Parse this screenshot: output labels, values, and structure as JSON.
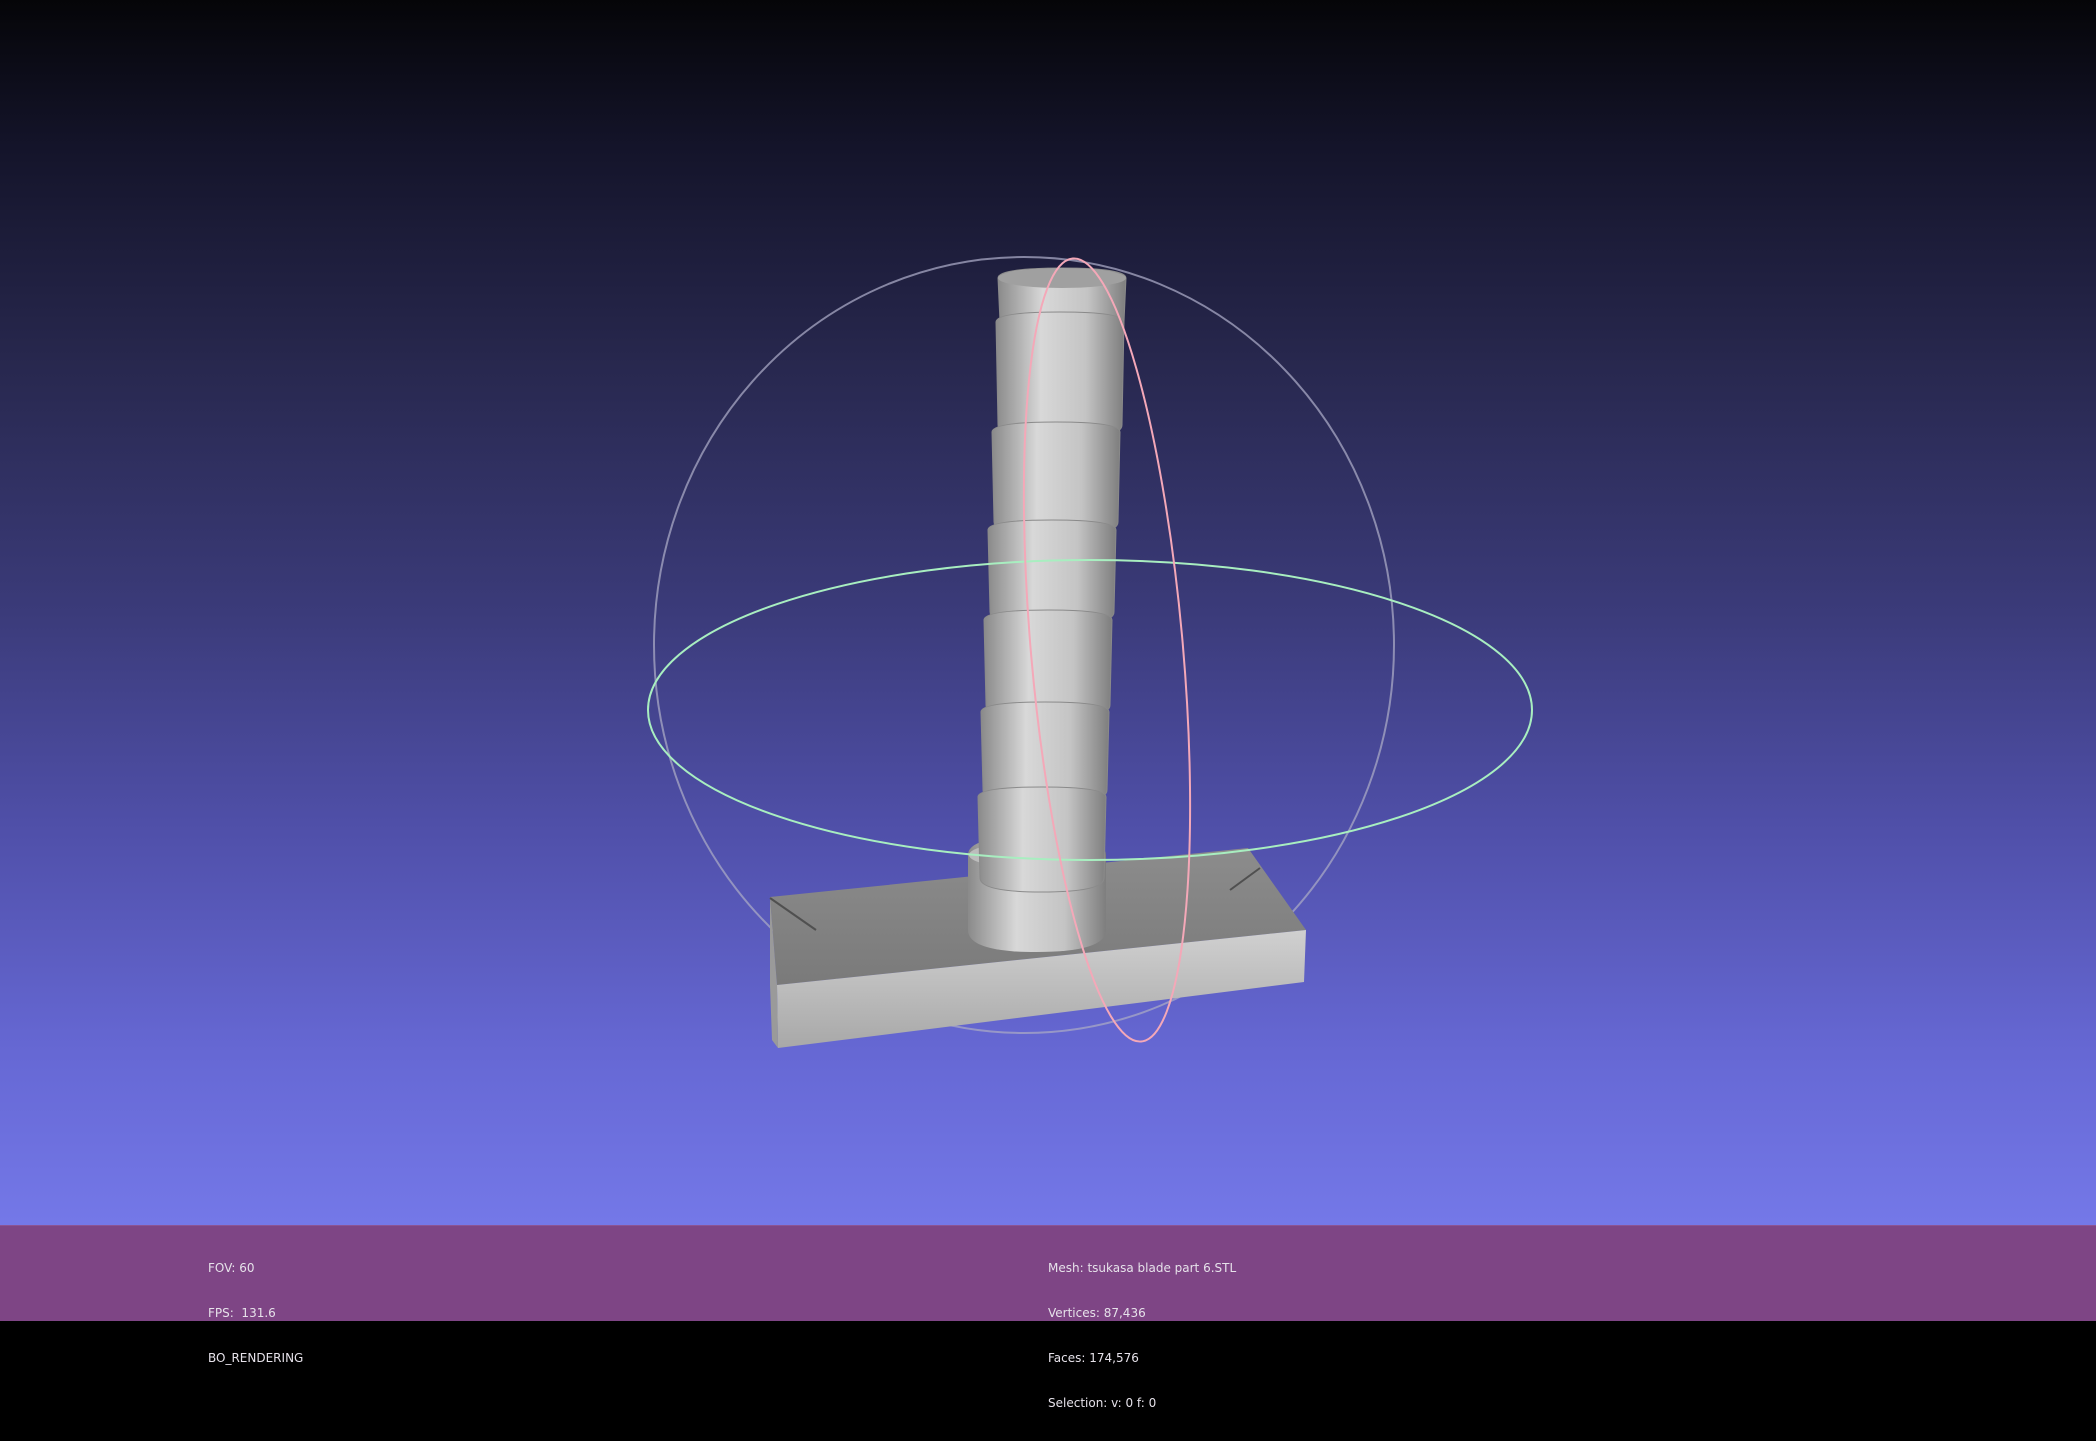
{
  "viewer": {
    "left_info": {
      "fov": "FOV: 60",
      "fps": "FPS:  131.6",
      "mode": "BO_RENDERING"
    },
    "mesh_info": {
      "mesh": "Mesh: tsukasa blade part 6.STL",
      "vertices": "Vertices: 87,436",
      "faces": "Faces: 174,576",
      "selection": "Selection: v: 0 f: 0"
    }
  },
  "colors": {
    "info_bar": "#7e4585",
    "info_text": "#e6e2ea",
    "model_gray": "#c8c8c8",
    "trackball_horizontal": "#a8f0c0",
    "trackball_vertical": "#f4a8b8",
    "trackball_outline": "#b0b0c8"
  }
}
